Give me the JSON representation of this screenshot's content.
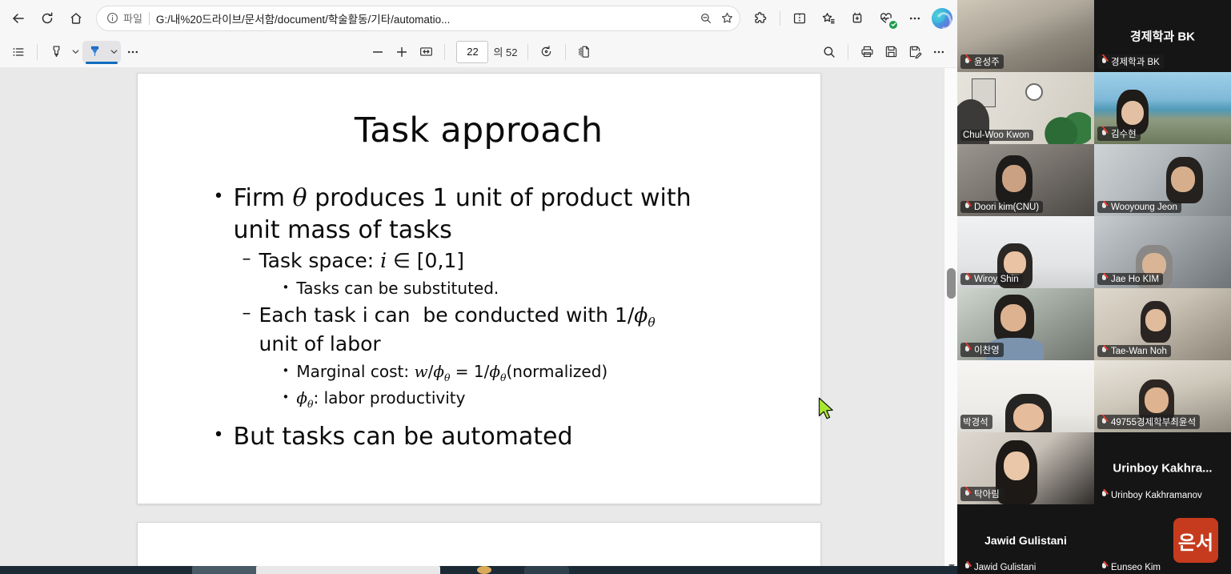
{
  "browser": {
    "nav": {
      "back_label": "Back",
      "refresh_label": "Refresh",
      "home_label": "Home",
      "scheme_label": "파일",
      "url": "G:/내%20드라이브/문서함/document/학술활동/기타/automatio...",
      "zoom_out_label": "Zoom out",
      "favorite_label": "Add this page to favorites",
      "extensions_label": "Extensions",
      "split_screen_label": "Split screen",
      "favorites_label": "Favorites",
      "collections_label": "Collections",
      "browser_essentials_label": "Browser essentials",
      "settings_label": "Settings and more",
      "copilot_label": "Copilot"
    },
    "pdf_toolbar": {
      "toc_label": "Table of contents",
      "highlight_label": "Highlight",
      "highlight_chevron_label": "Highlight options",
      "draw_label": "Draw",
      "draw_chevron_label": "Draw options",
      "more_tools_label": "More tools",
      "zoom_out_label": "Zoom out",
      "zoom_in_label": "Zoom in",
      "fit_page_label": "Fit to page",
      "current_page": "22",
      "page_total": "의 52",
      "rotate_label": "Rotate",
      "page_view_label": "Page view",
      "search_label": "Find on page",
      "print_label": "Print",
      "save_label": "Save",
      "save_as_label": "Save as",
      "more_label": "More options"
    },
    "slide": {
      "title": "Task approach",
      "bullets": [
        {
          "level": 1,
          "marker": "•",
          "html": "Firm <span class=\"mi\">θ</span> produces 1 unit of product with unit mass of tasks"
        },
        {
          "level": 2,
          "marker": "–",
          "html": "Task space: <span class=\"mi\">i</span> ∈ [0,1]"
        },
        {
          "level": 3,
          "marker": "•",
          "html": "Tasks can be substituted."
        },
        {
          "level": 2,
          "marker": "–",
          "html": "Each task i can&nbsp; be conducted with 1/<span class=\"mi\">ϕ</span><sub class=\"th\">θ</sub> unit of labor"
        },
        {
          "level": 3,
          "marker": "•",
          "html": "Marginal cost: <span class=\"mi\">w</span>/<span class=\"mi\">ϕ</span><sub class=\"th\">θ</sub> = 1/<span class=\"mi\">ϕ</span><sub class=\"th\">θ</sub>(normalized)"
        },
        {
          "level": 3,
          "marker": "•",
          "html": "<span class=\"mi\">ϕ</span><sub class=\"th\">θ</sub>: labor productivity"
        },
        {
          "level": 1,
          "marker": "•",
          "html": "But tasks can be automated"
        }
      ]
    }
  },
  "video": {
    "active_speaker_border_color": "#36e29a",
    "participants": [
      {
        "name": "윤성주",
        "type": "video",
        "bg": "#b8b0a2",
        "active": false
      },
      {
        "name": "경제학과 BK",
        "type": "name",
        "bg": "#151515",
        "active": false,
        "big": "경제학과 BK"
      },
      {
        "name": "Chul-Woo Kwon",
        "type": "video",
        "bg": "#d9d6ce",
        "active": true
      },
      {
        "name": "김수현",
        "type": "video",
        "bg": "#7fb4d6",
        "active": false
      },
      {
        "name": "Doori kim(CNU)",
        "type": "video",
        "bg": "#6e6a66",
        "active": false
      },
      {
        "name": "Wooyoung Jeon",
        "type": "video",
        "bg": "#a8aeb0",
        "active": false
      },
      {
        "name": "Wiroy Shin",
        "type": "video",
        "bg": "#e3e4e6",
        "active": false
      },
      {
        "name": "Jae Ho KIM",
        "type": "video",
        "bg": "#9fa3a8",
        "active": false
      },
      {
        "name": "이찬영",
        "type": "video",
        "bg": "#9aa39b",
        "active": false
      },
      {
        "name": "Tae-Wan Noh",
        "type": "video",
        "bg": "#cfc7ba",
        "active": false
      },
      {
        "name": "박경석",
        "type": "video",
        "bg": "#eceae6",
        "active": false
      },
      {
        "name": "49755경제학부최윤석",
        "type": "video",
        "bg": "#c9c3b4",
        "active": false
      },
      {
        "name": "탁아림",
        "type": "video",
        "bg": "#cdc6be",
        "active": false
      },
      {
        "name": "Urinboy Kakhramanov",
        "type": "name",
        "bg": "#151515",
        "active": false,
        "big": "Urinboy  Kakhra..."
      },
      {
        "name": "Jawid Gulistani",
        "type": "name",
        "bg": "#151515",
        "active": false,
        "big": "Jawid Gulistani"
      },
      {
        "name": "Eunseo Kim",
        "type": "avatar",
        "bg": "#151515",
        "active": false,
        "avatar_text": "은서",
        "avatar_color": "#c63b1e"
      }
    ]
  }
}
